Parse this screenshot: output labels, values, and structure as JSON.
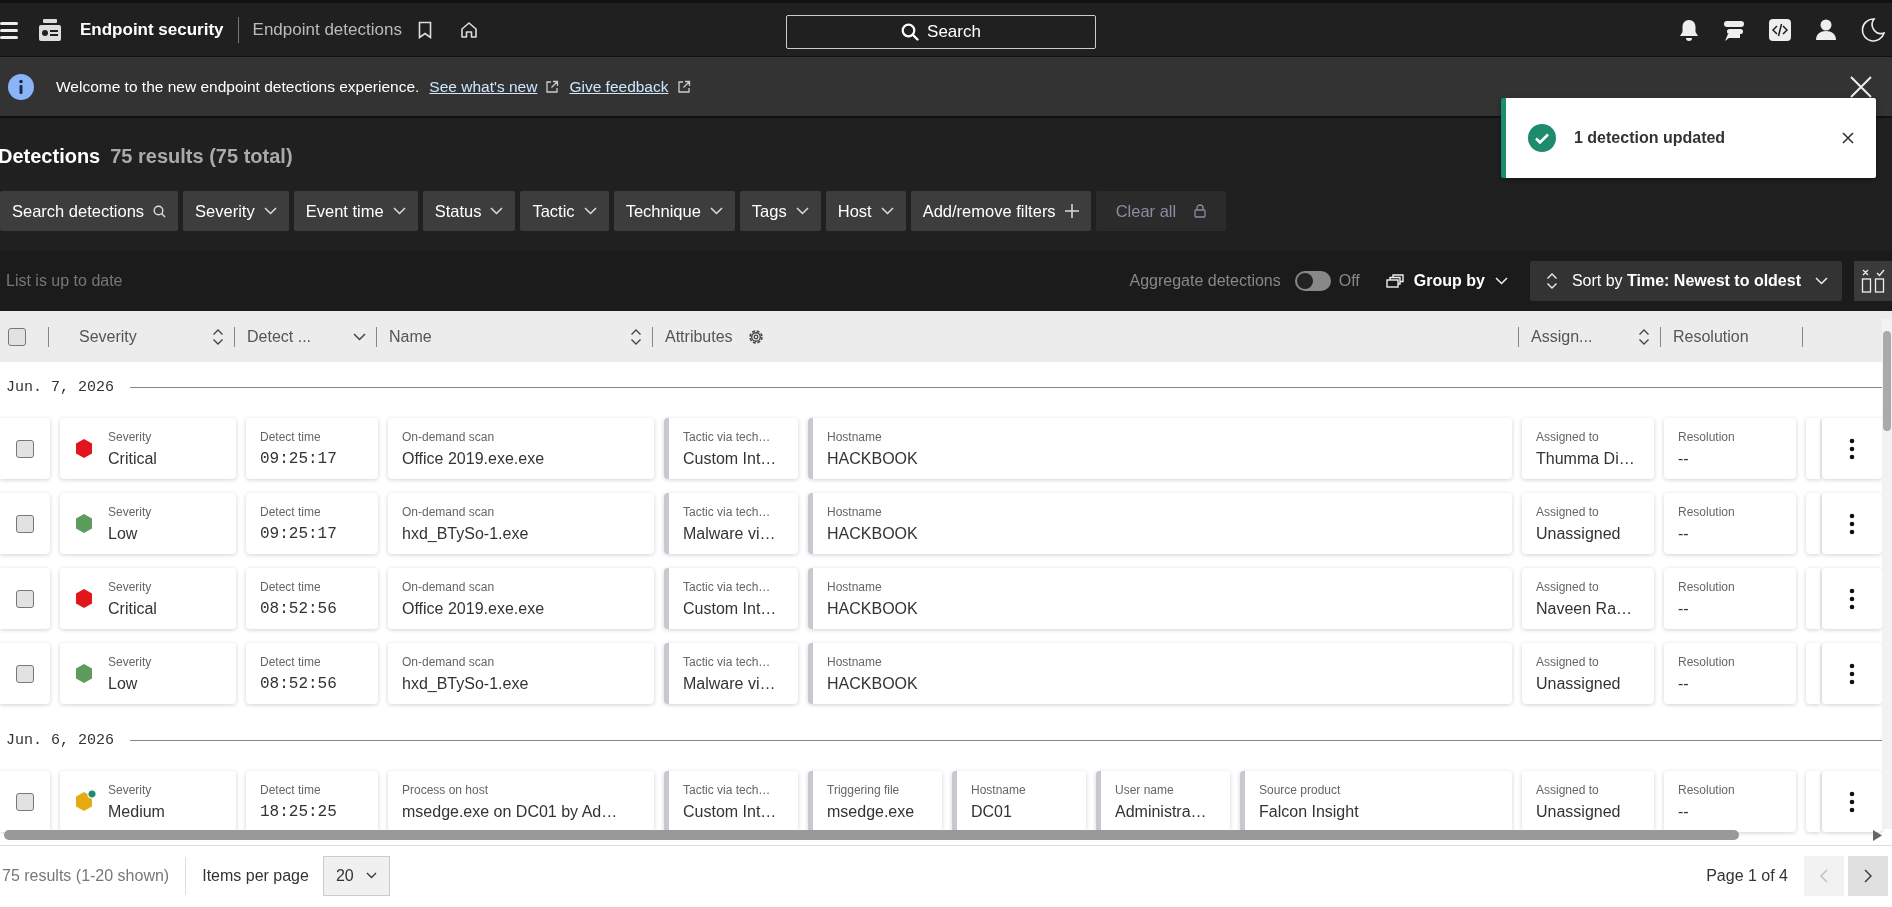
{
  "topbar": {
    "app": "Endpoint security",
    "breadcrumb": "Endpoint detections",
    "search": "Search"
  },
  "banner": {
    "text": "Welcome to the new endpoint detections experience.",
    "links": [
      "See what's new",
      "Give feedback"
    ]
  },
  "toast": {
    "message": "1 detection updated"
  },
  "header": {
    "title": "Detections",
    "count": "75 results (75 total)"
  },
  "filters": [
    {
      "label": "Search detections",
      "kind": "search"
    },
    {
      "label": "Severity",
      "kind": "dropdown"
    },
    {
      "label": "Event time",
      "kind": "dropdown"
    },
    {
      "label": "Status",
      "kind": "dropdown"
    },
    {
      "label": "Tactic",
      "kind": "dropdown"
    },
    {
      "label": "Technique",
      "kind": "dropdown"
    },
    {
      "label": "Tags",
      "kind": "dropdown"
    },
    {
      "label": "Host",
      "kind": "dropdown"
    },
    {
      "label": "Add/remove filters",
      "kind": "add"
    }
  ],
  "clear_all": {
    "label": "Clear all",
    "disabled": true
  },
  "toolbar": {
    "status": "List is up to date",
    "aggregate": {
      "label": "Aggregate detections",
      "on": false,
      "state": "Off"
    },
    "group_by": "Group by",
    "sort": {
      "prefix": "Sort by",
      "value": "Time: Newest to oldest"
    }
  },
  "columns": [
    {
      "label": "Severity",
      "kind": "sortable"
    },
    {
      "label": "Detect ...",
      "kind": "dropdown"
    },
    {
      "label": "Name",
      "kind": "sortable"
    },
    {
      "label": "Attributes",
      "kind": "configurable"
    },
    {
      "label": "Assign...",
      "kind": "sortable"
    },
    {
      "label": "Resolution",
      "kind": "plain"
    }
  ],
  "select_all": {
    "checked": false
  },
  "groups": [
    {
      "date": "Jun. 7, 2026",
      "rows": [
        {
          "checked": false,
          "severity": {
            "label": "Severity",
            "value": "Critical",
            "color": "#e3151c",
            "indicator": false
          },
          "time": {
            "label": "Detect time",
            "value": "09:25:17"
          },
          "name": {
            "label": "On-demand scan",
            "value": "Office 2019.exe.exe"
          },
          "attributes": [
            {
              "label": "Tactic via tech…",
              "value": "Custom Int…"
            },
            {
              "label": "Hostname",
              "value": "HACKBOOK"
            }
          ],
          "assigned": {
            "label": "Assigned to",
            "value": "Thumma Di…"
          },
          "resolution": {
            "label": "Resolution",
            "value": "--"
          }
        },
        {
          "checked": false,
          "severity": {
            "label": "Severity",
            "value": "Low",
            "color": "#5e9c5e",
            "indicator": false
          },
          "time": {
            "label": "Detect time",
            "value": "09:25:17"
          },
          "name": {
            "label": "On-demand scan",
            "value": "hxd_BTySo-1.exe"
          },
          "attributes": [
            {
              "label": "Tactic via tech…",
              "value": "Malware vi…"
            },
            {
              "label": "Hostname",
              "value": "HACKBOOK"
            }
          ],
          "assigned": {
            "label": "Assigned to",
            "value": "Unassigned"
          },
          "resolution": {
            "label": "Resolution",
            "value": "--"
          }
        },
        {
          "checked": false,
          "severity": {
            "label": "Severity",
            "value": "Critical",
            "color": "#e3151c",
            "indicator": false
          },
          "time": {
            "label": "Detect time",
            "value": "08:52:56"
          },
          "name": {
            "label": "On-demand scan",
            "value": "Office 2019.exe.exe"
          },
          "attributes": [
            {
              "label": "Tactic via tech…",
              "value": "Custom Int…"
            },
            {
              "label": "Hostname",
              "value": "HACKBOOK"
            }
          ],
          "assigned": {
            "label": "Assigned to",
            "value": "Naveen Ra…"
          },
          "resolution": {
            "label": "Resolution",
            "value": "--"
          }
        },
        {
          "checked": false,
          "severity": {
            "label": "Severity",
            "value": "Low",
            "color": "#5e9c5e",
            "indicator": false
          },
          "time": {
            "label": "Detect time",
            "value": "08:52:56"
          },
          "name": {
            "label": "On-demand scan",
            "value": "hxd_BTySo-1.exe"
          },
          "attributes": [
            {
              "label": "Tactic via tech…",
              "value": "Malware vi…"
            },
            {
              "label": "Hostname",
              "value": "HACKBOOK"
            }
          ],
          "assigned": {
            "label": "Assigned to",
            "value": "Unassigned"
          },
          "resolution": {
            "label": "Resolution",
            "value": "--"
          }
        }
      ]
    },
    {
      "date": "Jun. 6, 2026",
      "rows": [
        {
          "checked": false,
          "severity": {
            "label": "Severity",
            "value": "Medium",
            "color": "#e8aa14",
            "indicator": true
          },
          "time": {
            "label": "Detect time",
            "value": "18:25:25"
          },
          "name": {
            "label": "Process on host",
            "value": "msedge.exe on DC01 by Ad…"
          },
          "attributes": [
            {
              "label": "Tactic via tech…",
              "value": "Custom Int…"
            },
            {
              "label": "Triggering file",
              "value": "msedge.exe"
            },
            {
              "label": "Hostname",
              "value": "DC01"
            },
            {
              "label": "User name",
              "value": "Administra…"
            },
            {
              "label": "Source product",
              "value": "Falcon Insight"
            }
          ],
          "assigned": {
            "label": "Assigned to",
            "value": "Unassigned"
          },
          "resolution": {
            "label": "Resolution",
            "value": "--"
          }
        }
      ]
    }
  ],
  "pagination": {
    "summary": "75 results (1-20 shown)",
    "per_page_label": "Items per page",
    "per_page": "20",
    "page": "Page 1 of 4",
    "prev_disabled": true,
    "next_disabled": false
  }
}
